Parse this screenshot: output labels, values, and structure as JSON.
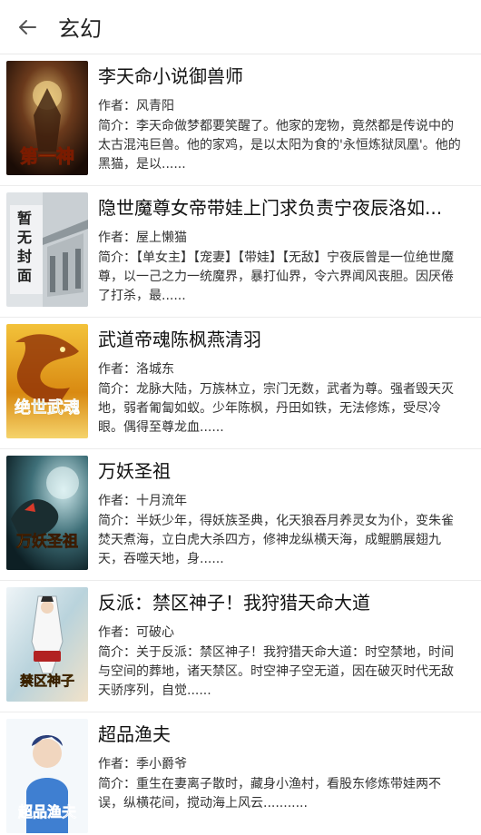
{
  "header": {
    "title": "玄幻"
  },
  "labels": {
    "author_prefix": "作者：",
    "intro_prefix": "简介："
  },
  "books": [
    {
      "title": "李天命小说御兽师",
      "author": "风青阳",
      "intro": "李天命做梦都要笑醒了。他家的宠物，竟然都是传说中的太古混沌巨兽。他的家鸡，是以太阳为食的'永恒炼狱凤凰'。他的黑猫，是以......",
      "cover_text": "第一神"
    },
    {
      "title": "隐世魔尊女帝带娃上门求负责宁夜辰洛如...",
      "author": "屋上懒猫",
      "intro": "【单女主】【宠妻】【带娃】【无敌】宁夜辰曾是一位绝世魔尊，以一己之力一统魔界，暴打仙界，令六界闻风丧胆。因厌倦了打杀，最......",
      "cover_text": "暂无封面"
    },
    {
      "title": "武道帝魂陈枫燕清羽",
      "author": "洛城东",
      "intro": "龙脉大陆，万族林立，宗门无数，武者为尊。强者毁天灭地，弱者匍匐如蚁。少年陈枫，丹田如铁，无法修炼，受尽冷眼。偶得至尊龙血......",
      "cover_text": "绝世武魂"
    },
    {
      "title": "万妖圣祖",
      "author": "十月流年",
      "intro": "半妖少年，得妖族圣典，化天狼吞月养灵女为仆，变朱雀焚天煮海，立白虎大杀四方，修神龙纵横天海，成鲲鹏展翅九天，吞噬天地，身......",
      "cover_text": "万妖圣祖"
    },
    {
      "title": "反派：禁区神子！我狩猎天命大道",
      "author": "可破心",
      "intro": "关于反派：禁区神子！我狩猎天命大道：时空禁地，时间与空间的葬地，诸天禁区。时空神子空无道，因在破灭时代无敌天骄序列，自觉......",
      "cover_text": "禁区神子"
    },
    {
      "title": "超品渔夫",
      "author": "季小爵爷",
      "intro": "重生在妻离子散时，藏身小渔村，看股东修炼带娃两不误，纵横花间，搅动海上风云...........",
      "cover_text": "超品渔夫"
    }
  ]
}
